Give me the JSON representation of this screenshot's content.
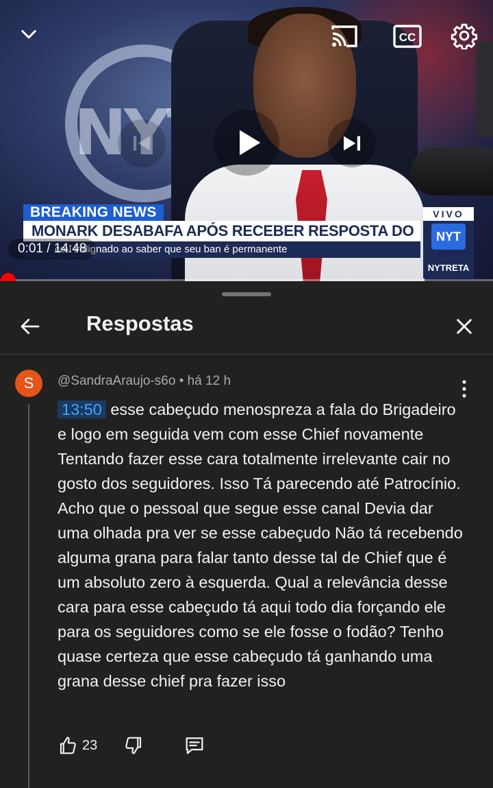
{
  "video": {
    "breaking_label": "BREAKING NEWS",
    "headline": "MONARK DESABAFA APÓS RECEBER RESPOSTA DO YOUTUBE",
    "subline": "cou indignado ao saber que seu ban é permanente",
    "live_badge": "VIVO",
    "live_logo_text": "NYT",
    "channel_label": "NYTRETA",
    "background_logo": "NYT",
    "time_current": "0:01",
    "time_separator": " / ",
    "time_total": "14:48",
    "progress_fraction": 0.001
  },
  "panel": {
    "title": "Respostas"
  },
  "comment": {
    "avatar_letter": "S",
    "author": "@SandraAraujo-s6o",
    "separator": " • ",
    "age": "há 12 h",
    "timestamp_link": "13:50",
    "text": " esse cabeçudo menospreza a fala do Brigadeiro e logo em seguida vem com esse Chief novamente Tentando fazer esse cara totalmente irrelevante cair no gosto dos seguidores. Isso Tá parecendo até Patrocínio. Acho que o pessoal que segue esse canal Devia dar uma olhada pra ver se esse cabeçudo Não tá recebendo alguma grana para falar tanto desse tal de Chief  que é um absoluto zero à esquerda. Qual a relevância desse cara para esse cabeçudo tá aqui todo dia forçando ele para os seguidores como se ele fosse o fodão? Tenho quase certeza que esse cabeçudo tá ganhando uma grana desse chief pra fazer isso",
    "like_count": "23"
  },
  "colors": {
    "panel_bg": "#212121",
    "accent_red": "#ff0000",
    "link_blue": "#3ea6ff",
    "avatar_orange": "#e4541b"
  },
  "icons": {
    "minimize": "chevron-down-icon",
    "cast": "cast-icon",
    "captions": "cc-icon",
    "settings": "gear-icon",
    "previous": "skip-previous-icon",
    "play": "play-icon",
    "next": "skip-next-icon",
    "back": "arrow-left-icon",
    "close": "close-icon",
    "more": "more-vertical-icon",
    "like": "thumbs-up-icon",
    "dislike": "thumbs-down-icon",
    "reply": "reply-comment-icon"
  }
}
